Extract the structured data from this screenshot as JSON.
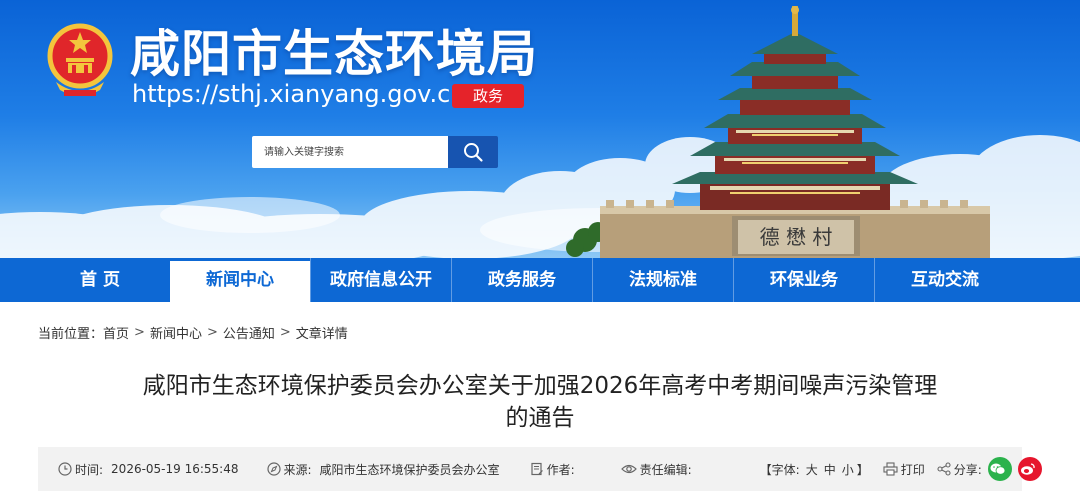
{
  "header": {
    "site_title": "咸阳市生态环境局",
    "site_url": "https://sthj.xianyang.gov.cn/",
    "badge": "政务",
    "gate_plaque": "德 懋 村"
  },
  "search": {
    "placeholder": "请输入关键字搜索"
  },
  "nav": {
    "items": [
      {
        "label": "首 页"
      },
      {
        "label": "新闻中心"
      },
      {
        "label": "政府信息公开"
      },
      {
        "label": "政务服务"
      },
      {
        "label": "法规标准"
      },
      {
        "label": "环保业务"
      },
      {
        "label": "互动交流"
      }
    ],
    "active_index": 1
  },
  "breadcrumb": {
    "prefix": "当前位置：",
    "items": [
      "首页",
      "新闻中心",
      "公告通知",
      "文章详情"
    ],
    "separator": ">"
  },
  "article": {
    "title_line1": "咸阳市生态环境保护委员会办公室关于加强2026年高考中考期间噪声污染管理",
    "title_line2": "的通告"
  },
  "meta": {
    "time_label": "时间:",
    "time_value": "2026-05-19 16:55:48",
    "source_label": "来源:",
    "source_value": "咸阳市生态环境保护委员会办公室",
    "author_label": "作者:",
    "author_value": "",
    "editor_label": "责任编辑:",
    "editor_value": "",
    "font_label": "【字体:",
    "font_large": "大",
    "font_medium": "中",
    "font_small": "小",
    "font_close": "】",
    "print_label": "打印",
    "share_label": "分享:"
  },
  "colors": {
    "nav_bg": "#0d68d4",
    "badge_bg": "#e5232a",
    "search_button": "#1754b0",
    "wechat": "#2bb24c",
    "weibo": "#e6162d"
  },
  "icons": {
    "search": "magnifier-icon",
    "time": "clock-icon",
    "source": "compass-icon",
    "author": "edit-document-icon",
    "editor": "eye-icon",
    "print": "printer-icon",
    "share": "share-icon",
    "wechat": "wechat-icon",
    "weibo": "weibo-icon"
  }
}
